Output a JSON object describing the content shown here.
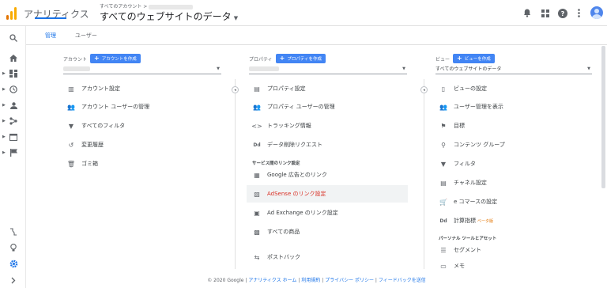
{
  "header": {
    "app_name": "アナリティクス",
    "breadcrumb": "すべてのアカウント >",
    "view_title": "すべてのウェブサイトのデータ",
    "icons": [
      "bell-icon",
      "apps-grid-icon",
      "help-icon",
      "more-vert-icon",
      "account-avatar"
    ]
  },
  "tabs": [
    {
      "label": "管理",
      "active": true
    },
    {
      "label": "ユーザー",
      "active": false
    }
  ],
  "account": {
    "heading": "アカウント",
    "create_label": "アカウントを作成",
    "items": [
      {
        "label": "アカウント設定",
        "icon": "building-icon"
      },
      {
        "label": "アカウント ユーザーの管理",
        "icon": "people-icon"
      },
      {
        "label": "すべてのフィルタ",
        "icon": "filter-icon"
      },
      {
        "label": "変更履歴",
        "icon": "history-icon"
      },
      {
        "label": "ゴミ箱",
        "icon": "trash-icon"
      }
    ]
  },
  "property": {
    "heading": "プロパティ",
    "create_label": "プロパティを作成",
    "items": [
      {
        "label": "プロパティ設定",
        "icon": "layout-icon"
      },
      {
        "label": "プロパティ ユーザーの管理",
        "icon": "people-icon"
      },
      {
        "label": "トラッキング情報",
        "icon": "code-icon"
      },
      {
        "label": "データ削除リクエスト",
        "icon": "dd-icon"
      }
    ],
    "section_title": "サービス間のリンク設定",
    "link_items": [
      {
        "label": "Google 広告とのリンク",
        "icon": "ads-icon"
      },
      {
        "label": "AdSense のリンク設定",
        "icon": "adsense-icon"
      },
      {
        "label": "Ad Exchange のリンク設定",
        "icon": "adexchange-icon"
      },
      {
        "label": "すべての商品",
        "icon": "products-icon"
      },
      {
        "label": "ポストバック",
        "icon": "postback-icon"
      }
    ]
  },
  "view": {
    "heading": "ビュー",
    "create_label": "ビューを作成",
    "selected": "すべてのウェブサイトのデータ",
    "items": [
      {
        "label": "ビューの設定",
        "icon": "doc-icon"
      },
      {
        "label": "ユーザー管理を表示",
        "icon": "people-icon"
      },
      {
        "label": "目標",
        "icon": "flag-icon"
      },
      {
        "label": "コンテンツ グループ",
        "icon": "person-walk-icon"
      },
      {
        "label": "フィルタ",
        "icon": "filter-icon"
      },
      {
        "label": "チャネル設定",
        "icon": "channel-icon"
      },
      {
        "label": "e コマースの設定",
        "icon": "cart-icon"
      },
      {
        "label": "計算指標",
        "tag": "ベータ版",
        "icon": "dd-icon"
      }
    ],
    "section_title": "パーソナル ツールとアセット",
    "extra_items": [
      {
        "label": "セグメント",
        "icon": "segment-icon"
      },
      {
        "label": "メモ",
        "icon": "note-icon"
      }
    ]
  },
  "footer": {
    "copyright": "© 2020 Google",
    "sep": "|",
    "links": [
      "アナリティクス ホーム",
      "利用規約",
      "プライバシー ポリシー",
      "フィードバックを送信"
    ]
  },
  "colors": {
    "accent": "#1a73e8",
    "button": "#4285f4",
    "adsense_red": "#d93025"
  }
}
